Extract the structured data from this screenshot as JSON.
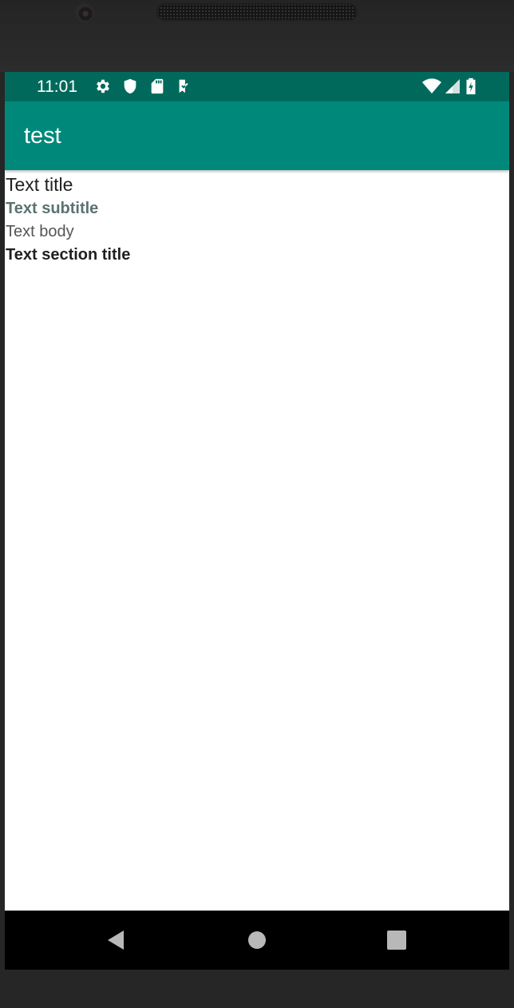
{
  "status_bar": {
    "time": "11:01",
    "left_icons": [
      "gear-icon",
      "shield-icon",
      "sd-card-icon",
      "checklist-icon"
    ],
    "right_icons": [
      "wifi-icon",
      "signal-icon",
      "battery-charging-icon"
    ],
    "background": "#00695c"
  },
  "app_bar": {
    "title": "test",
    "background": "#00897b"
  },
  "content": {
    "title": "Text title",
    "subtitle": "Text subtitle",
    "body": "Text body",
    "section_title": "Text section title"
  },
  "nav_bar": {
    "buttons": [
      "back-icon",
      "home-icon",
      "recents-icon"
    ]
  }
}
